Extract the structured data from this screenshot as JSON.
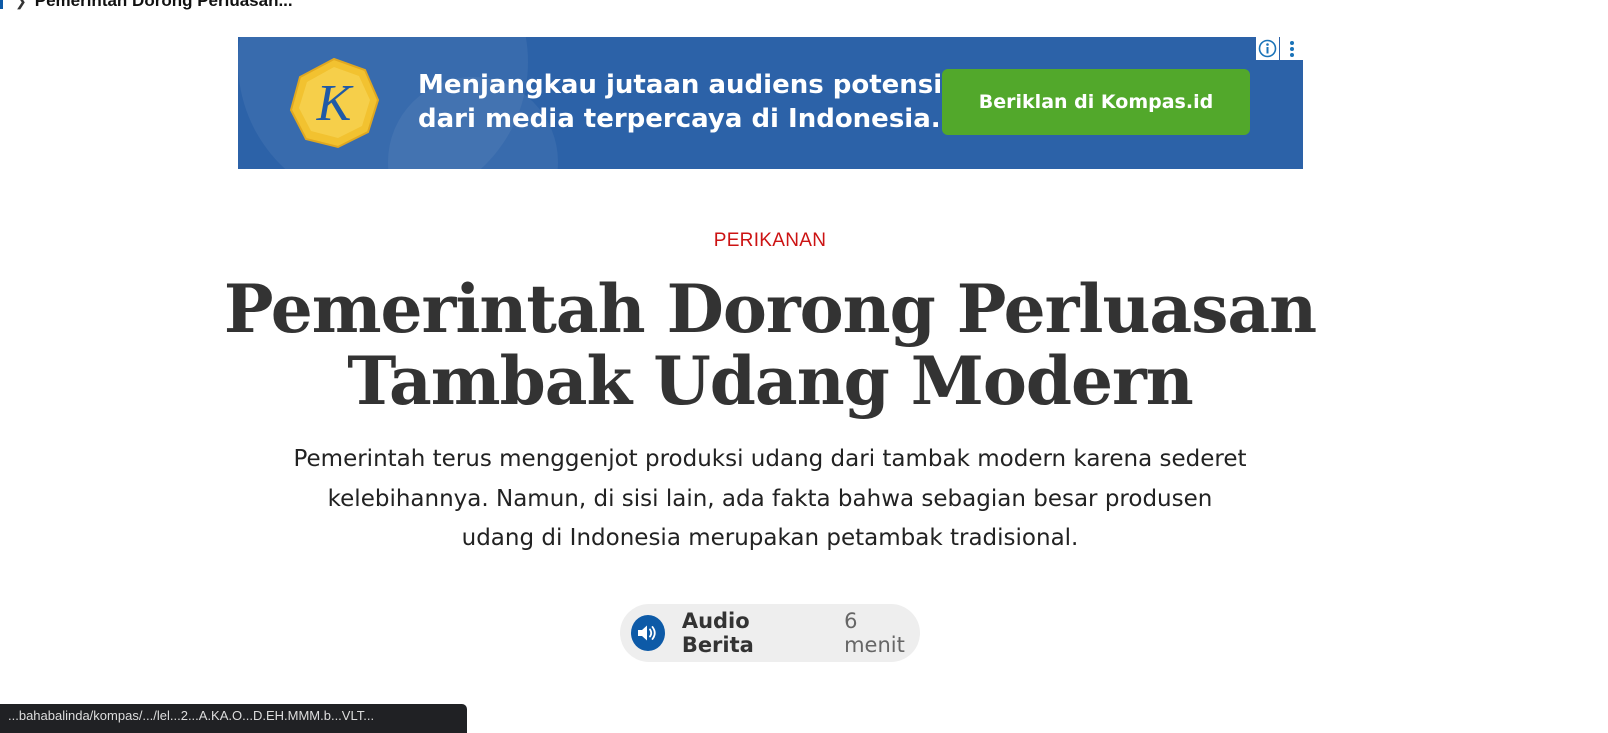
{
  "breadcrumb": {
    "current": "Pemerintah Dorong Perluasan..."
  },
  "ad": {
    "logo_letter": "K",
    "line1": "Menjangkau jutaan audiens potensial",
    "line2": "dari media terpercaya di Indonesia.",
    "cta": "Beriklan di Kompas.id",
    "colors": {
      "background": "#2c62a8",
      "cta": "#52a82b",
      "logo": "#f2c230"
    }
  },
  "article": {
    "category": "PERIKANAN",
    "title": "Pemerintah Dorong Perluasan Tambak Udang Modern",
    "lede": "Pemerintah terus menggenjot produksi udang dari tambak modern karena sederet kelebihannya. Namun, di sisi lain, ada fakta bahwa sebagian besar produsen udang di Indonesia merupakan petambak tradisional."
  },
  "audio": {
    "icon": "speaker-icon",
    "label": "Audio Berita",
    "duration": "6 menit"
  },
  "status_bar": {
    "url": "...bahabalinda/kompas/.../lel...2...A.KA.O...D.EH.MMM.b...VLT..."
  },
  "colors": {
    "category": "#cc1313",
    "accent": "#0d5aa7",
    "text": "#333333"
  }
}
